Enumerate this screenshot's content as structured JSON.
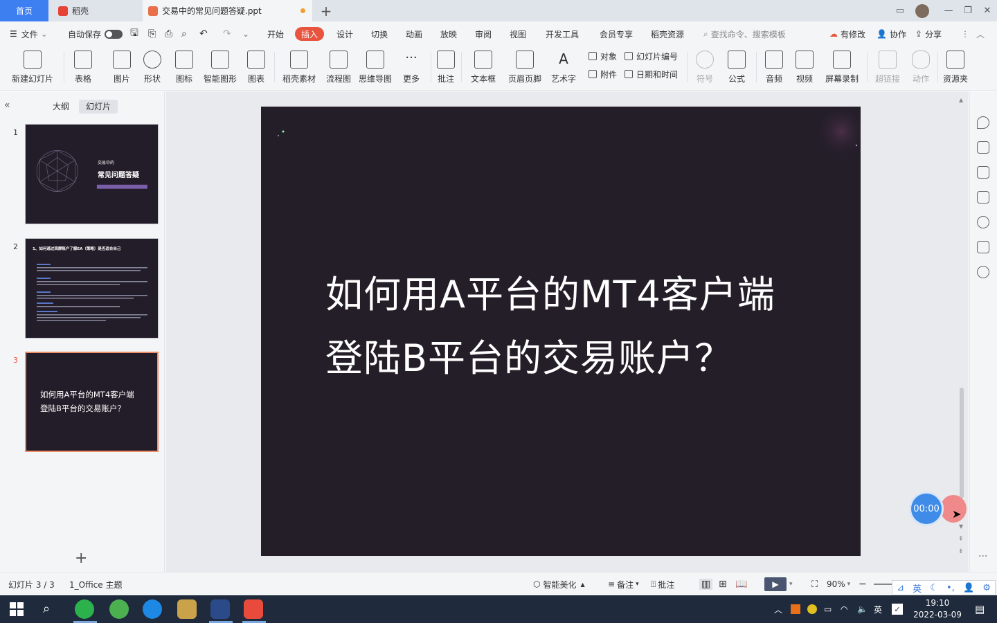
{
  "tabs": {
    "home": "首页",
    "daoke": "稻壳",
    "document": "交易中的常见问题答疑.ppt",
    "add": "+"
  },
  "menu": {
    "file": "文件",
    "autosave": "自动保存",
    "items": [
      "开始",
      "插入",
      "设计",
      "切换",
      "动画",
      "放映",
      "审阅",
      "视图",
      "开发工具",
      "会员专享",
      "稻壳资源"
    ],
    "active": "插入",
    "search": "查找命令、搜索模板",
    "modified": "有修改",
    "collab": "协作",
    "share": "分享"
  },
  "ribbon": {
    "new_slide": "新建幻灯片",
    "table": "表格",
    "picture": "图片",
    "shape": "形状",
    "icon": "图标",
    "smartart": "智能图形",
    "chart": "图表",
    "material": "稻壳素材",
    "flowchart": "流程图",
    "mindmap": "思维导图",
    "more": "更多",
    "comment": "批注",
    "textbox": "文本框",
    "header_footer": "页眉页脚",
    "wordart": "艺术字",
    "object": "对象",
    "attachment": "附件",
    "slide_number": "幻灯片编号",
    "datetime": "日期和时间",
    "symbol": "符号",
    "formula": "公式",
    "audio": "音频",
    "video": "视频",
    "screen_record": "屏幕录制",
    "hyperlink": "超链接",
    "action": "动作",
    "resource": "资源夹"
  },
  "panel": {
    "outline_tab": "大纲",
    "slides_tab": "幻灯片",
    "slide_numbers": [
      "1",
      "2",
      "3"
    ],
    "thumb1_small": "交易中的",
    "thumb1_title": "常见问题答疑",
    "thumb2_heading": "1、如何通过观摩账户了解EA（策略）是否适合自己",
    "thumb3_line1": "如何用A平台的MT4客户端",
    "thumb3_line2": "登陆B平台的交易账户？"
  },
  "slide": {
    "title_line1": "如何用A平台的MT4客户端",
    "title_line2": "登陆B平台的交易账户？"
  },
  "timer": "00:00",
  "status": {
    "slide_info": "幻灯片 3 / 3",
    "theme": "1_Office 主题",
    "beautify": "智能美化",
    "notes": "备注",
    "comment": "批注",
    "zoom": "90%"
  },
  "ime": {
    "lang": "英"
  },
  "taskbar": {
    "time": "19:10",
    "date": "2022-03-09",
    "lang": "英"
  },
  "colors": {
    "accent_red": "#e8543d",
    "tab_blue": "#3d7ff1",
    "slide_bg": "#241e29"
  }
}
